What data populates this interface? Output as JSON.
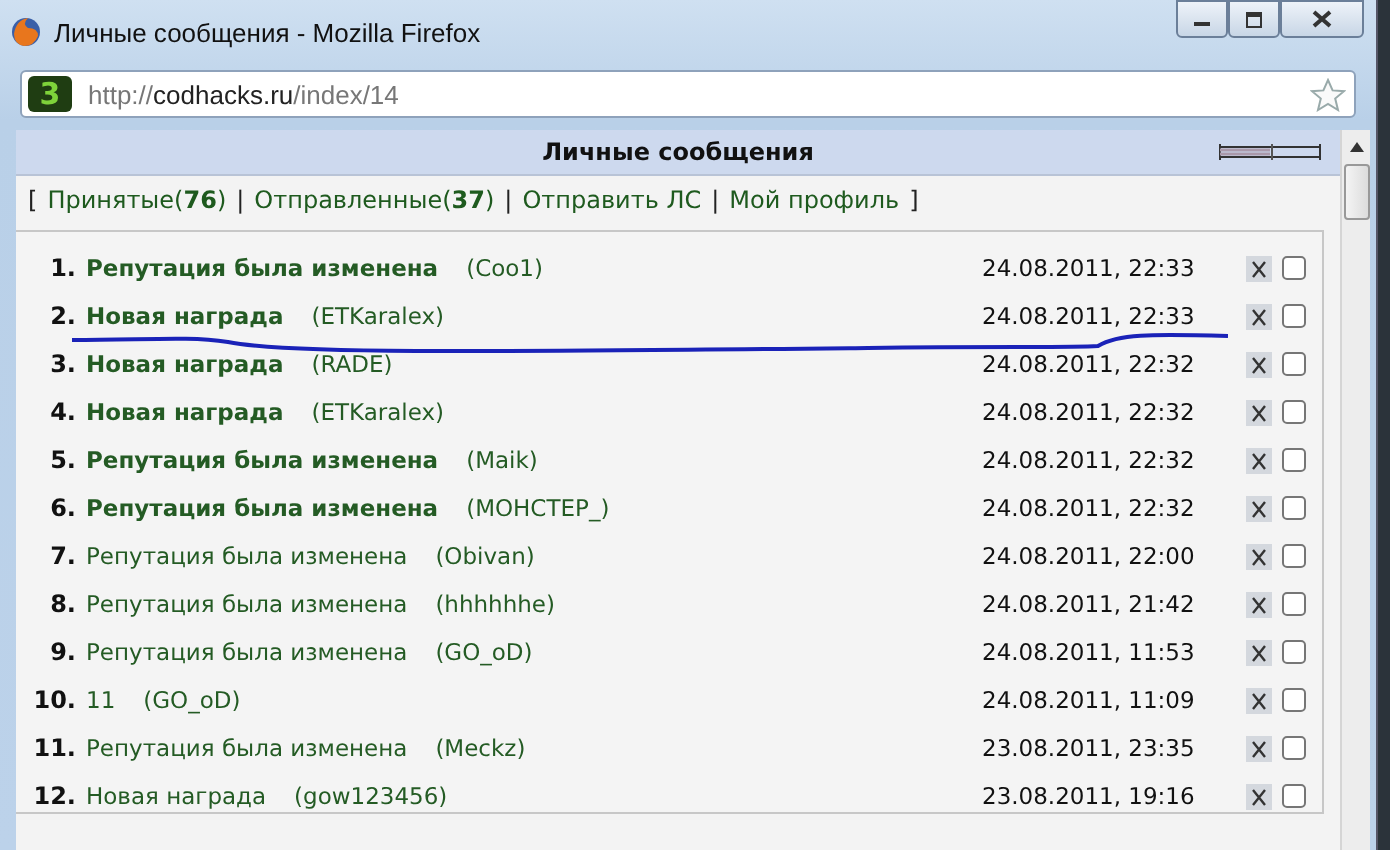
{
  "window": {
    "title": "Личные сообщения - Mozilla Firefox"
  },
  "address_bar": {
    "site_icon_glyph": "3",
    "url": {
      "scheme": "http://",
      "host": "codhacks.ru",
      "path": "/index/14"
    }
  },
  "panel": {
    "title": "Личные сообщения"
  },
  "nav": [
    {
      "kind": "bracket",
      "text": "["
    },
    {
      "kind": "link",
      "text": "Принятые(**76**)"
    },
    {
      "kind": "separator",
      "text": "|"
    },
    {
      "kind": "link",
      "text": "Отправленные(**37**)"
    },
    {
      "kind": "separator",
      "text": "|"
    },
    {
      "kind": "link",
      "text": "Отправить ЛС"
    },
    {
      "kind": "separator",
      "text": "|"
    },
    {
      "kind": "link",
      "text": "Мой профиль"
    },
    {
      "kind": "bracket",
      "text": "]"
    }
  ],
  "messages": [
    {
      "number": "1.",
      "subject": "Репутация была изменена",
      "author": "(Coo1)",
      "date": "24.08.2011, 22:33",
      "unread": true,
      "checked": false
    },
    {
      "number": "2.",
      "subject": "Новая награда",
      "author": "(ETKaralex)",
      "date": "24.08.2011, 22:33",
      "unread": true,
      "checked": false
    },
    {
      "number": "3.",
      "subject": "Новая награда",
      "author": "(RADE)",
      "date": "24.08.2011, 22:32",
      "unread": true,
      "checked": false
    },
    {
      "number": "4.",
      "subject": "Новая награда",
      "author": "(ETKaralex)",
      "date": "24.08.2011, 22:32",
      "unread": true,
      "checked": false
    },
    {
      "number": "5.",
      "subject": "Репутация была изменена",
      "author": "(Maik)",
      "date": "24.08.2011, 22:32",
      "unread": true,
      "checked": false
    },
    {
      "number": "6.",
      "subject": "Репутация была изменена",
      "author": "(МОНСТЕР_)",
      "date": "24.08.2011, 22:32",
      "unread": true,
      "checked": false
    },
    {
      "number": "7.",
      "subject": "Репутация была изменена",
      "author": "(Obivan)",
      "date": "24.08.2011, 22:00",
      "unread": false,
      "checked": false
    },
    {
      "number": "8.",
      "subject": "Репутация была изменена",
      "author": "(hhhhhhe)",
      "date": "24.08.2011, 21:42",
      "unread": false,
      "checked": false
    },
    {
      "number": "9.",
      "subject": "Репутация была изменена",
      "author": "(GO_oD)",
      "date": "24.08.2011, 11:53",
      "unread": false,
      "checked": false
    },
    {
      "number": "10.",
      "subject": "11",
      "author": "(GO_oD)",
      "date": "24.08.2011, 11:09",
      "unread": false,
      "checked": false
    },
    {
      "number": "11.",
      "subject": "Репутация была изменена",
      "author": "(Meckz)",
      "date": "23.08.2011, 23:35",
      "unread": false,
      "checked": false
    },
    {
      "number": "12.",
      "subject": "Новая награда",
      "author": "(gow123456)",
      "date": "23.08.2011, 19:16",
      "unread": false,
      "checked": false
    }
  ]
}
